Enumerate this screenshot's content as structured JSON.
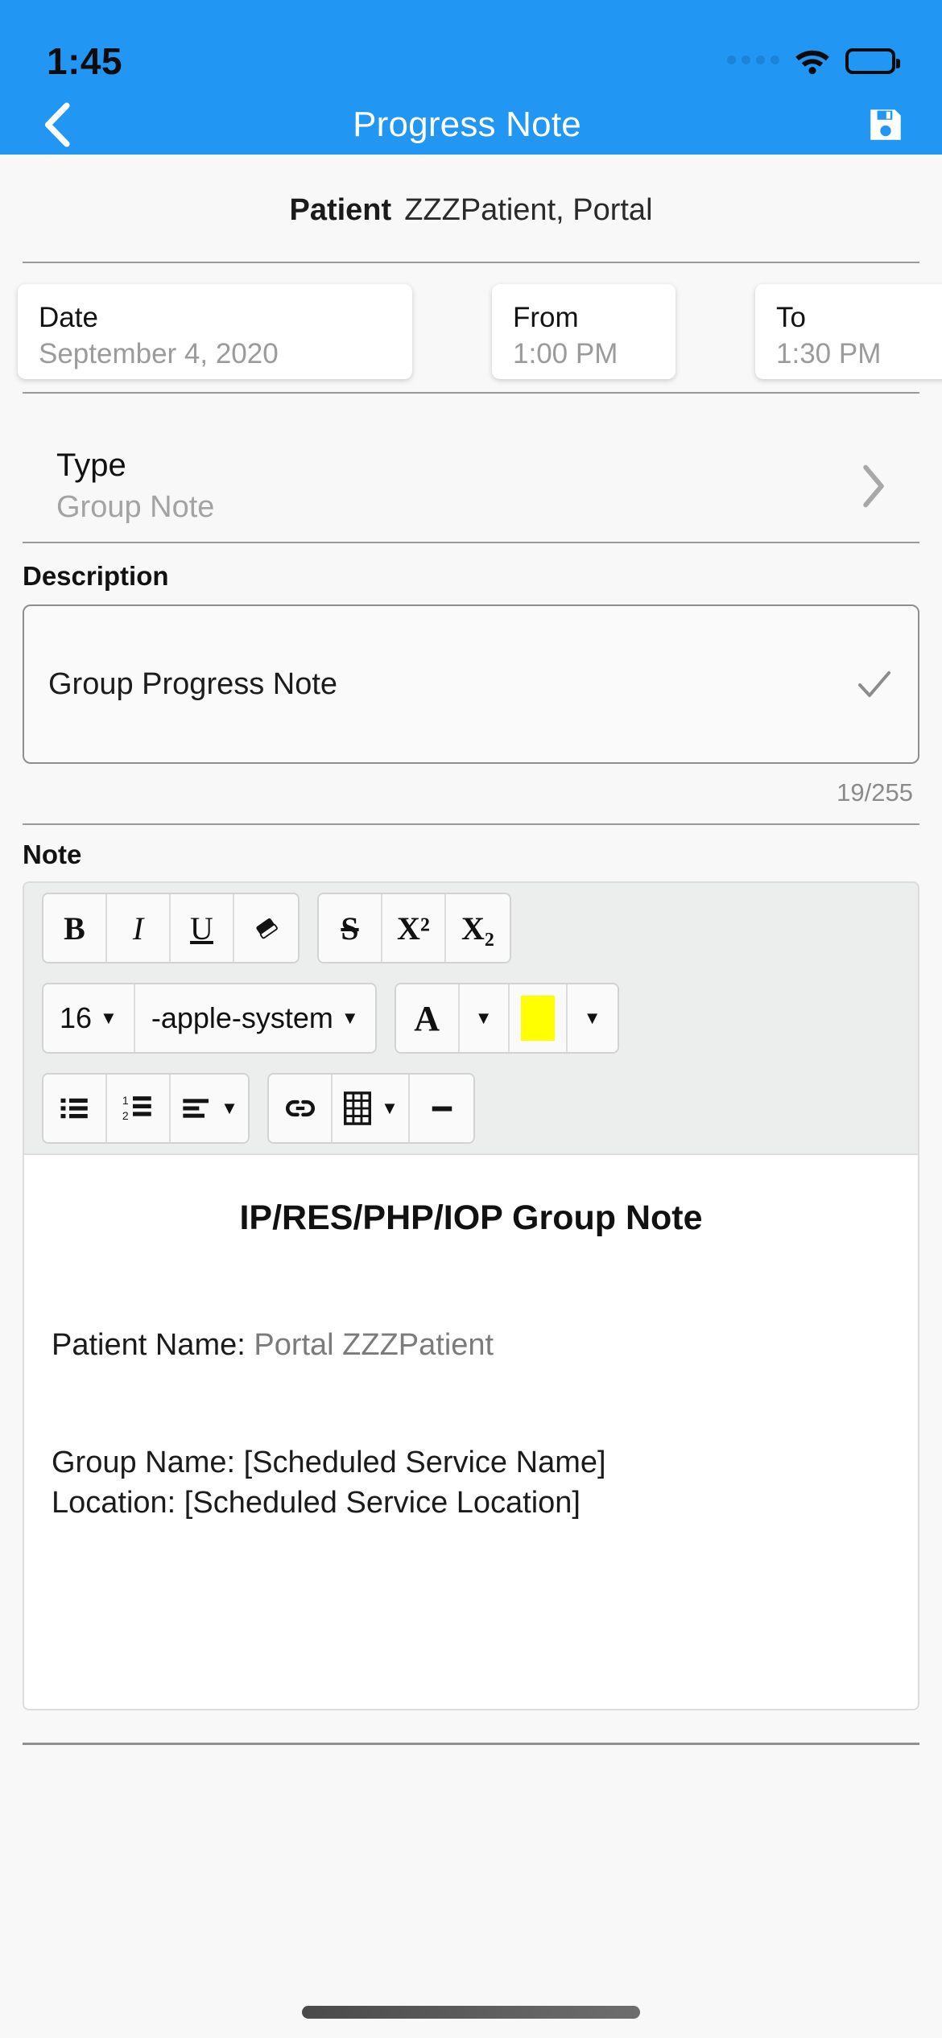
{
  "status_bar": {
    "time": "1:45",
    "signal_icon": "signal-dots-icon",
    "wifi_icon": "wifi-icon",
    "battery_icon": "battery-full-icon"
  },
  "nav": {
    "back_icon": "chevron-left-icon",
    "title": "Progress Note",
    "save_icon": "save-floppy-icon"
  },
  "patient": {
    "label": "Patient",
    "value": "ZZZPatient, Portal"
  },
  "schedule": {
    "date": {
      "label": "Date",
      "value": "September 4, 2020"
    },
    "from": {
      "label": "From",
      "value": "1:00 PM"
    },
    "to": {
      "label": "To",
      "value": "1:30 PM"
    }
  },
  "type": {
    "label": "Type",
    "value": "Group Note",
    "chevron_icon": "chevron-right-icon"
  },
  "description": {
    "heading": "Description",
    "value": "Group Progress Note",
    "check_icon": "check-icon",
    "counter": "19/255"
  },
  "note": {
    "heading": "Note",
    "toolbar": {
      "row1": [
        {
          "name": "bold-button",
          "label": "B"
        },
        {
          "name": "italic-button",
          "label": "I"
        },
        {
          "name": "underline-button",
          "label": "U"
        },
        {
          "name": "clear-format-button",
          "label": "eraser-icon"
        },
        {
          "name": "strikethrough-button",
          "label": "S"
        },
        {
          "name": "superscript-button",
          "label": "X²"
        },
        {
          "name": "subscript-button",
          "label": "X₂"
        }
      ],
      "font_size": "16",
      "font_family": "-apple-system",
      "text_color_label": "A",
      "highlight_color": "#ffff00",
      "row3": [
        {
          "name": "bullet-list-button",
          "label": "bullet-list-icon"
        },
        {
          "name": "numbered-list-button",
          "label": "numbered-list-icon"
        },
        {
          "name": "align-button",
          "label": "align-left-icon"
        },
        {
          "name": "link-button",
          "label": "link-icon"
        },
        {
          "name": "table-button",
          "label": "table-icon"
        },
        {
          "name": "horizontal-rule-button",
          "label": "horizontal-rule-icon"
        }
      ]
    },
    "body": {
      "title": "IP/RES/PHP/IOP Group Note",
      "patient_name_label": "Patient Name: ",
      "patient_name_value": "Portal ZZZPatient",
      "group_name_line": "Group Name: [Scheduled Service Name]",
      "location_line": "Location: [Scheduled Service Location]"
    }
  },
  "colors": {
    "accent": "#2196f3",
    "highlight": "#ffff00",
    "background": "#f8f8f8"
  }
}
